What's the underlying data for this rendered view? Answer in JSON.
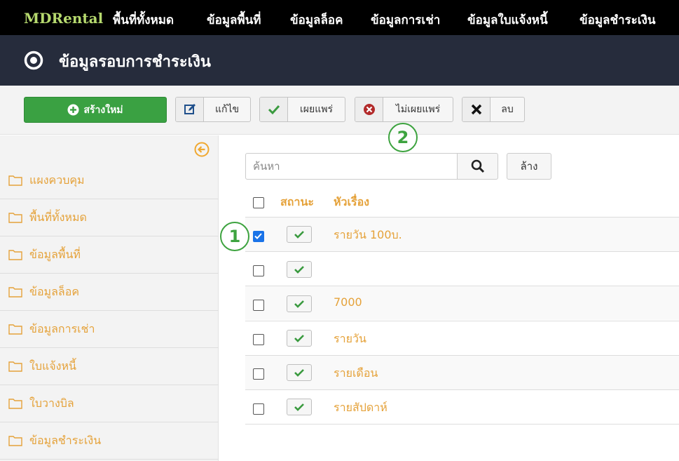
{
  "nav": {
    "brand": "MDRental",
    "items": [
      "พื้นที่ทั้งหมด",
      "ข้อมูลพื้นที่",
      "ข้อมูลล็อค",
      "ข้อมูลการเช่า",
      "ข้อมูลใบแจ้งหนี้",
      "ข้อมูลชำระเงิน"
    ]
  },
  "page": {
    "title": "ข้อมูลรอบการชำระเงิน"
  },
  "toolbar": {
    "new_label": "สร้างใหม่",
    "edit_label": "แก้ไข",
    "publish_label": "เผยแพร่",
    "unpublish_label": "ไม่เผยแพร่",
    "delete_label": "ลบ"
  },
  "sidebar": {
    "items": [
      "แผงควบคุม",
      "พื้นที่ทั้งหมด",
      "ข้อมูลพื้นที่",
      "ข้อมูลล็อค",
      "ข้อมูลการเช่า",
      "ใบแจ้งหนี้",
      "ใบวางบิล",
      "ข้อมูลชำระเงิน"
    ]
  },
  "search": {
    "placeholder": "ค้นหา",
    "clear_label": "ล้าง"
  },
  "table": {
    "headers": {
      "status": "สถานะ",
      "title": "หัวเรื่อง"
    },
    "rows": [
      {
        "title": "รายวัน 100บ.",
        "checked": true,
        "published": true
      },
      {
        "title": "",
        "checked": false,
        "published": true
      },
      {
        "title": "7000",
        "checked": false,
        "published": true
      },
      {
        "title": "รายวัน",
        "checked": false,
        "published": true
      },
      {
        "title": "รายเดือน",
        "checked": false,
        "published": true
      },
      {
        "title": "รายสัปดาห์",
        "checked": false,
        "published": true
      }
    ]
  },
  "annotations": {
    "marker_1": "1",
    "marker_2": "2"
  },
  "colors": {
    "accent": "#e5a23a",
    "brand": "#b6d96e",
    "success": "#3aa142",
    "titlebar": "#262c3c"
  }
}
